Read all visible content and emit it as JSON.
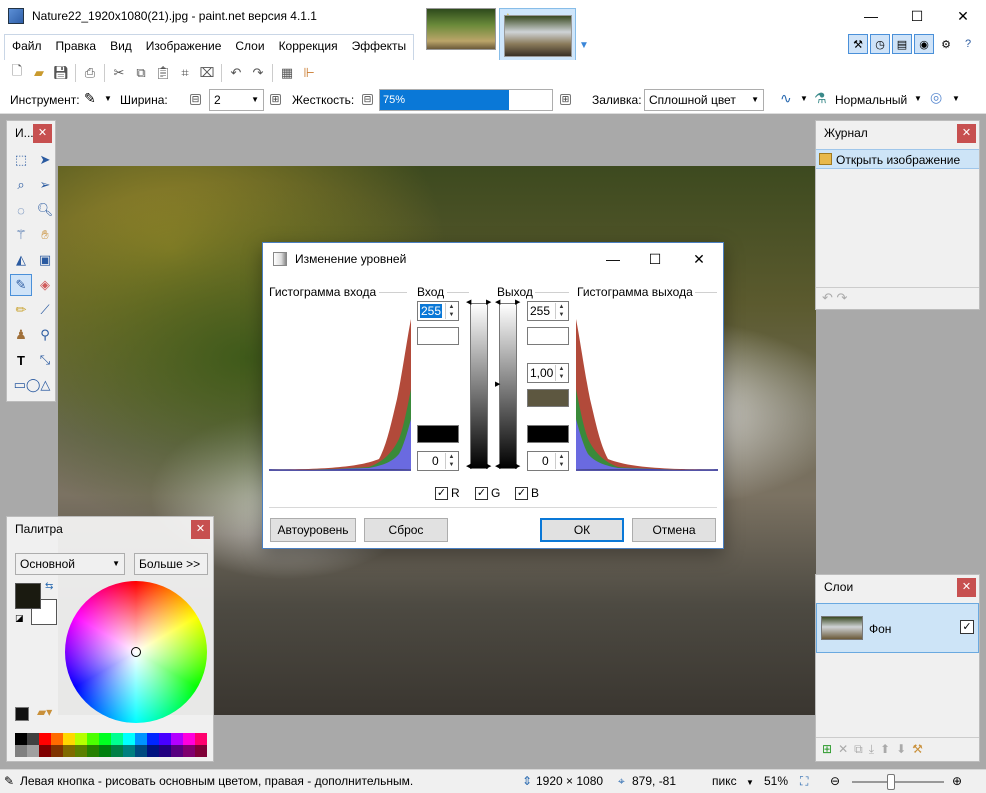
{
  "window": {
    "title": "Nature22_1920x1080(21).jpg - paint.net версия 4.1.1",
    "minimize": "—",
    "maximize": "☐",
    "close": "✕"
  },
  "menu": {
    "items": [
      "Файл",
      "Правка",
      "Вид",
      "Изображение",
      "Слои",
      "Коррекция",
      "Эффекты"
    ]
  },
  "toolbar": {
    "tool_label": "Инструмент:",
    "width_label": "Ширина:",
    "width_value": "2",
    "hardness_label": "Жесткость:",
    "hardness_value": "75%",
    "hardness_fraction": 0.75,
    "fill_label": "Заливка:",
    "fill_value": "Сплошной цвет",
    "blend_value": "Нормальный",
    "minus": "⊟",
    "plus": "⊞"
  },
  "tools_panel": {
    "title": "И..."
  },
  "history_panel": {
    "title": "Журнал",
    "items": [
      "Открыть изображение"
    ],
    "undo": "↶",
    "redo": "↷"
  },
  "palette_panel": {
    "title": "Палитра",
    "mode": "Основной",
    "more_button": "Больше >>",
    "colors": {
      "primary": "#1a1a10",
      "secondary": "#ffffff"
    },
    "swatch_colors": [
      "#000000",
      "#404040",
      "#ff0000",
      "#ff6a00",
      "#ffd800",
      "#b6ff00",
      "#4cff00",
      "#00ff21",
      "#00ff90",
      "#00ffff",
      "#0094ff",
      "#0026ff",
      "#4800ff",
      "#b200ff",
      "#ff00dc",
      "#ff006e",
      "#808080",
      "#a0a0a0",
      "#7f0000",
      "#7f3300",
      "#7f6a00",
      "#5b7f00",
      "#267f00",
      "#007f0e",
      "#007f46",
      "#007f7f",
      "#004a7f",
      "#00137f",
      "#21007f",
      "#57007f",
      "#7f006e",
      "#7f0037"
    ]
  },
  "layers_panel": {
    "title": "Слои",
    "layers": [
      {
        "name": "Фон",
        "visible": "✓"
      }
    ]
  },
  "dialog": {
    "title": "Изменение уровней",
    "input_histogram": "Гистограмма входа",
    "output_histogram": "Гистограмма выхода",
    "input_label": "Вход",
    "output_label": "Выход",
    "input_high": "255",
    "input_low": "0",
    "output_high": "255",
    "output_gamma": "1,00",
    "output_low": "0",
    "midtone_color": "#5d5740",
    "channels": [
      {
        "name": "R",
        "checked": "✓"
      },
      {
        "name": "G",
        "checked": "✓"
      },
      {
        "name": "B",
        "checked": "✓"
      }
    ],
    "auto_button": "Автоуровень",
    "reset_button": "Сброс",
    "ok_button": "ОК",
    "cancel_button": "Отмена"
  },
  "status": {
    "hint": "Левая кнопка - рисовать основным цветом, правая - дополнительным.",
    "image_size": "1920 × 1080",
    "cursor_pos": "879, -81",
    "units": "пикс",
    "zoom": "51%"
  }
}
